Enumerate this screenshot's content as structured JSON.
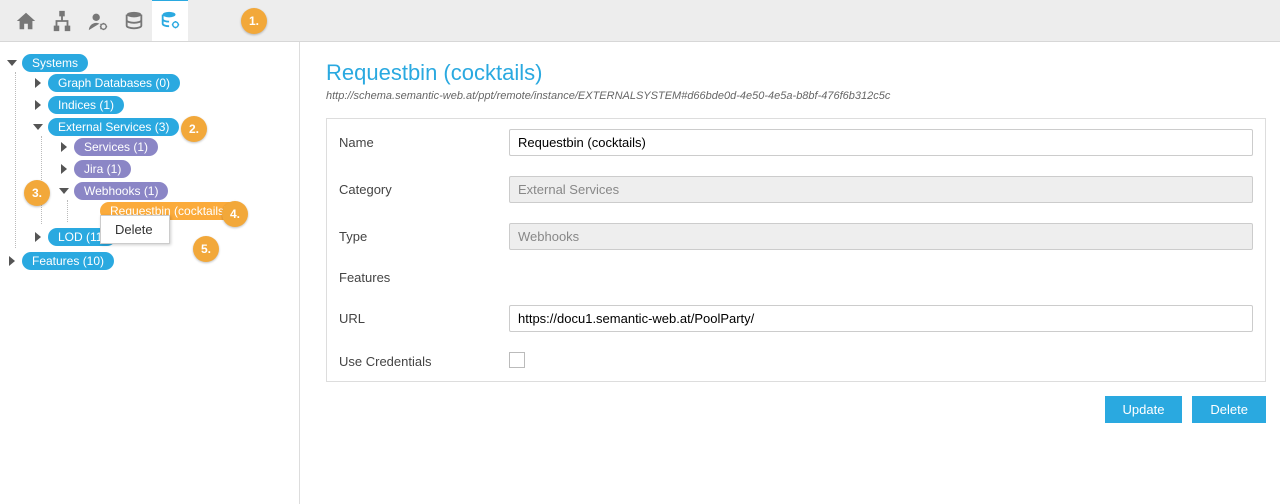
{
  "annotations": {
    "a1": "1.",
    "a2": "2.",
    "a3": "3.",
    "a4": "4.",
    "a5": "5."
  },
  "toolbar": {
    "icons": {
      "home": "home-icon",
      "sitemap": "sitemap-icon",
      "user": "user-settings-icon",
      "db": "database-icon",
      "dbactive": "database-config-icon"
    }
  },
  "tree": {
    "systems": "Systems",
    "graph_db": "Graph Databases (0)",
    "indices": "Indices (1)",
    "ext_services": "External Services (3)",
    "services": "Services (1)",
    "jira": "Jira (1)",
    "webhooks": "Webhooks (1)",
    "requestbin": "Requestbin (cocktails)",
    "lod": "LOD (11)",
    "features": "Features (10)"
  },
  "context_menu": {
    "delete": "Delete"
  },
  "main": {
    "title": "Requestbin (cocktails)",
    "uri": "http://schema.semantic-web.at/ppt/remote/instance/EXTERNALSYSTEM#d66bde0d-4e50-4e5a-b8bf-476f6b312c5c",
    "fields": {
      "name_label": "Name",
      "name_value": "Requestbin (cocktails)",
      "category_label": "Category",
      "category_value": "External Services",
      "type_label": "Type",
      "type_value": "Webhooks",
      "features_label": "Features",
      "url_label": "URL",
      "url_value": "https://docu1.semantic-web.at/PoolParty/",
      "credentials_label": "Use Credentials",
      "credentials_checked": false
    },
    "buttons": {
      "update": "Update",
      "delete": "Delete"
    }
  }
}
